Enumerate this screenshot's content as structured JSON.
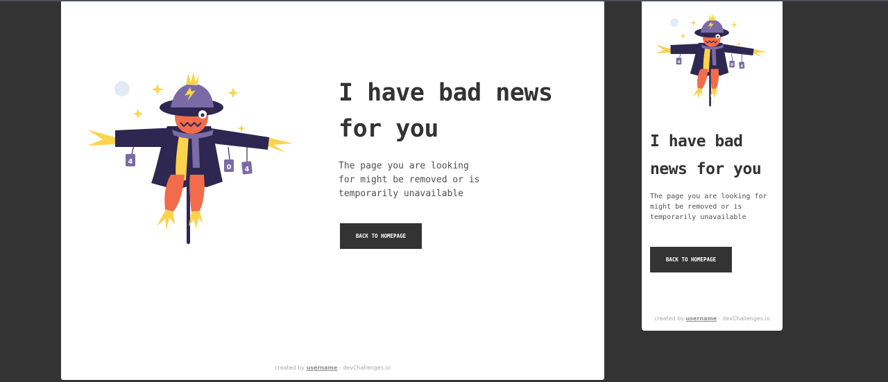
{
  "colors": {
    "background": "#333333",
    "card": "#ffffff",
    "text": "#333333",
    "muted": "#4f4f4f",
    "accent_orange": "#f26b4b",
    "accent_yellow": "#fcd34d",
    "accent_purple": "#2e2751"
  },
  "illustration": {
    "sign_left": "4",
    "sign_mid": "0",
    "sign_right": "4"
  },
  "page": {
    "title": "I have bad news for you",
    "description": "The page you are looking for might be removed or is temporarily unavailable",
    "button_label": "BACK TO HOMEPAGE",
    "footer": {
      "prefix": "created by",
      "username": "username",
      "suffix": "- devChallenges.io"
    }
  }
}
